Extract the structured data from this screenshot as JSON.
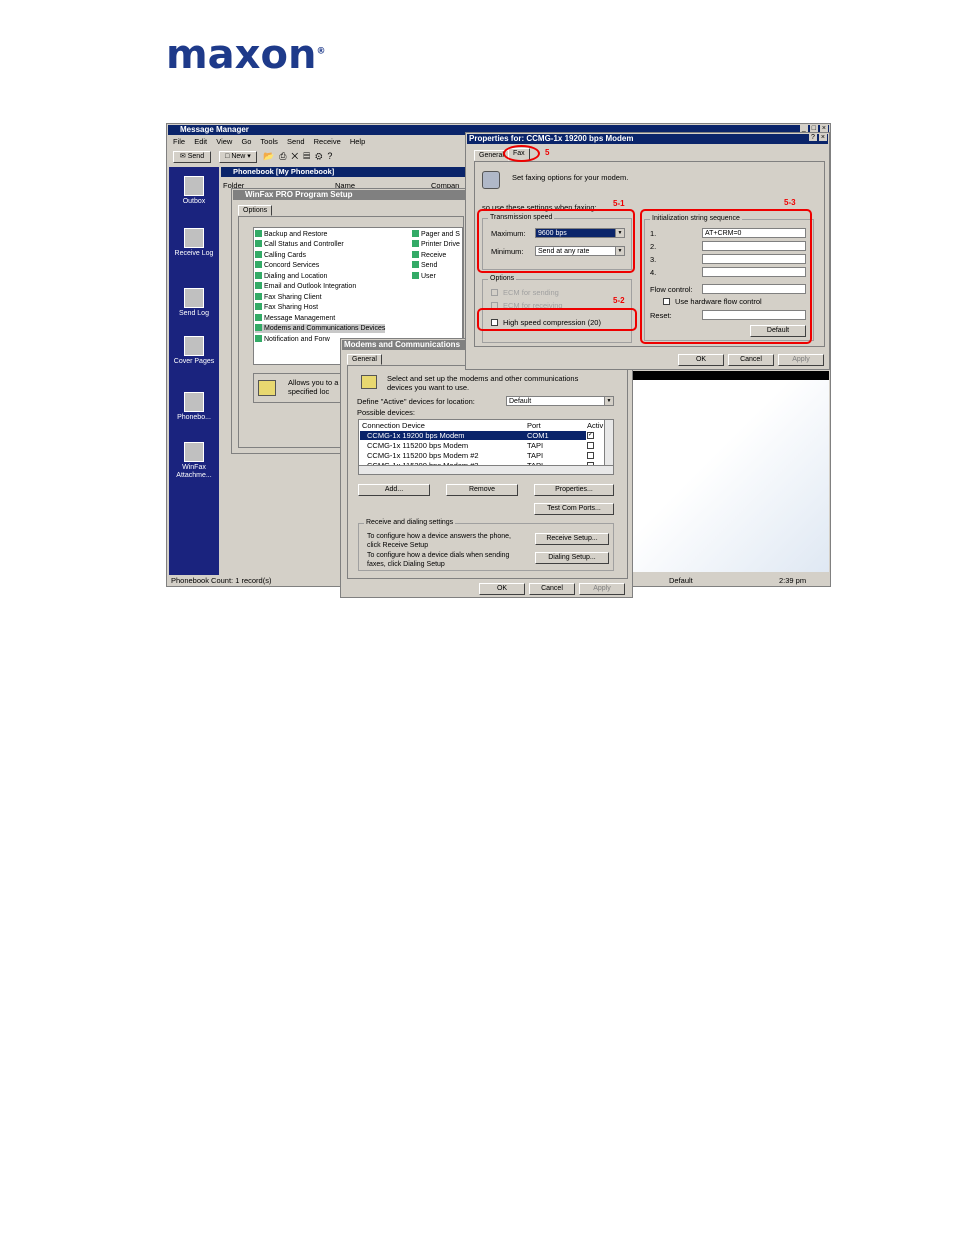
{
  "logo": {
    "text": "maxon",
    "reg": "®"
  },
  "main": {
    "title": "Message Manager",
    "menu": [
      "File",
      "Edit",
      "View",
      "Go",
      "Tools",
      "Send",
      "Receive",
      "Help"
    ],
    "toolbar_send": "Send",
    "toolbar_new": "New",
    "phonebook_title": "Phonebook [My Phonebook]",
    "col_folder": "Folder",
    "col_name": "Name",
    "col_company": "Compan",
    "status_count": "Phonebook Count:  1 record(s)",
    "status_default": "Default",
    "status_time": "2:39 pm",
    "sidebar": [
      "Outbox",
      "Receive Log",
      "Send Log",
      "Cover Pages",
      "Phonebo...",
      "WinFax Attachme..."
    ]
  },
  "setup": {
    "title": "WinFax PRO Program Setup",
    "tab": "Options",
    "items": [
      "Backup and Restore",
      "Call Status and Controller",
      "Calling Cards",
      "Concord Services",
      "Dialing and Location",
      "Email and Outlook Integration",
      "Fax Sharing Client",
      "Fax Sharing Host",
      "Message Management",
      "Modems and Communications Devices",
      "Notification and Forw"
    ],
    "items_right": [
      "Pager and S",
      "Printer Drive",
      "Receive",
      "Send",
      "User"
    ],
    "desc": "Allows you to a specified loc"
  },
  "modems": {
    "title": "Modems and Communications",
    "tab": "General",
    "intro": "Select and set up the modems and other communications devices you want to use.",
    "define_label": "Define \"Active\" devices for location:",
    "location": "Default",
    "possible": "Possible devices:",
    "col_device": "Connection Device",
    "col_port": "Port",
    "col_active": "Activ",
    "devices": [
      {
        "name": "CCMG-1x  19200 bps Modem",
        "port": "COM1"
      },
      {
        "name": "CCMG-1x 115200 bps Modem",
        "port": "TAPI"
      },
      {
        "name": "CCMG-1x 115200 bps Modem #2",
        "port": "TAPI"
      },
      {
        "name": "CCMG-1x 115200 bps Modem #3",
        "port": "TAPI"
      }
    ],
    "btn_add": "Add...",
    "btn_remove": "Remove",
    "btn_props": "Properties...",
    "btn_test": "Test Com Ports...",
    "recv_group": "Receive and dialing settings",
    "recv_text": "To configure how a device answers the phone, click Receive Setup",
    "dial_text": "To configure how a device dials when sending faxes, click Dialing Setup",
    "btn_recv": "Receive Setup...",
    "btn_dial": "Dialing Setup...",
    "ok": "OK",
    "cancel": "Cancel",
    "apply": "Apply"
  },
  "props": {
    "title": "Properties for: CCMG-1x  19200 bps Modem",
    "tab_general": "General",
    "tab_fax": "Fax",
    "intro": "Set faxing options for your modem.",
    "use_label": "so use these settings when faxing:",
    "trans_group": "Transmission speed",
    "max_label": "Maximum:",
    "max_value": "9600 bps",
    "min_label": "Minimum:",
    "min_value": "Send at any rate",
    "options_group": "Options",
    "ecm_send": "ECM for sending",
    "ecm_recv": "ECM for receiving",
    "high_speed": "High speed compression (20)",
    "init_group": "Initialization string sequence",
    "init1_label": "1.",
    "init1_value": "AT+CRM=0",
    "init2_label": "2.",
    "init3_label": "3.",
    "init4_label": "4.",
    "flow_label": "Flow control:",
    "hw_flow": "Use hardware flow control",
    "reset_label": "Reset:",
    "btn_default": "Default",
    "ok": "OK",
    "cancel": "Cancel",
    "apply": "Apply"
  },
  "annotations": {
    "a5": "5",
    "a51": "5-1",
    "a52": "5-2",
    "a53": "5-3"
  }
}
